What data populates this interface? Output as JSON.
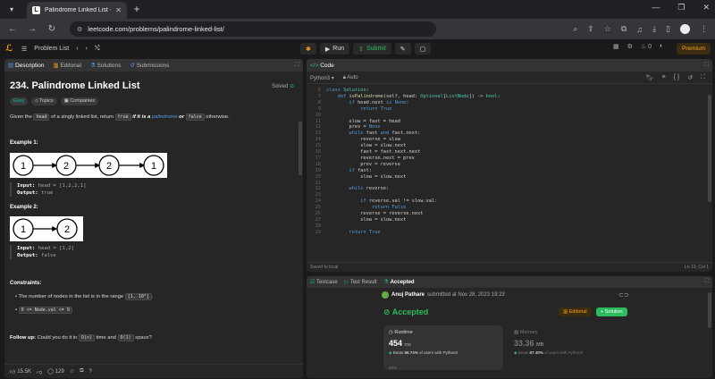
{
  "browser": {
    "tab_title": "Palindrome Linked List - LeetC",
    "url": "leetcode.com/problems/palindrome-linked-list/"
  },
  "nav": {
    "problem_list": "Problem List",
    "run": "Run",
    "submit": "Submit",
    "streak_count": "0",
    "premium": "Premium"
  },
  "left_tabs": [
    "Description",
    "Editorial",
    "Solutions",
    "Submissions"
  ],
  "problem": {
    "title": "234. Palindrome Linked List",
    "status": "Solved",
    "difficulty": "Easy",
    "topics": "Topics",
    "companies": "Companies",
    "desc_pre": "Given the ",
    "desc_code1": "head",
    "desc_mid1": " of a singly linked list, return ",
    "desc_code2": "true",
    "desc_em1": " if it is a ",
    "desc_link": "palindrome",
    "desc_em2": " or ",
    "desc_code3": "false",
    "desc_post": " otherwise.",
    "example1_title": "Example 1:",
    "example1_nodes": [
      "1",
      "2",
      "2",
      "1"
    ],
    "example1_input_label": "Input:",
    "example1_input": "head = [1,2,2,1]",
    "example1_output_label": "Output:",
    "example1_output": "true",
    "example2_title": "Example 2:",
    "example2_nodes": [
      "1",
      "2"
    ],
    "example2_input_label": "Input:",
    "example2_input": "head = [1,2]",
    "example2_output_label": "Output:",
    "example2_output": "false",
    "constraints_title": "Constraints:",
    "constraint1_pre": "The number of nodes in the list is in the range ",
    "constraint1_code": "[1, 10⁵]",
    "constraint1_post": ".",
    "constraint2_code": "0 <= Node.val <= 9",
    "followup_label": "Follow up:",
    "followup_pre": " Could you do it in ",
    "followup_code1": "O(n)",
    "followup_mid": " time and ",
    "followup_code2": "O(1)",
    "followup_post": " space?"
  },
  "left_bottom": {
    "likes": "15.5K",
    "comments": "129"
  },
  "code_panel": {
    "tab": "Code",
    "language": "Python3",
    "mode": "Auto",
    "saved": "Saved to local",
    "cursor": "Ln 10, Col 1",
    "line_numbers": [
      "6",
      "7",
      "8",
      "9",
      "10",
      "11",
      "12",
      "13",
      "14",
      "15",
      "16",
      "17",
      "18",
      "19",
      "20",
      "21",
      "22",
      "23",
      "24",
      "25",
      "26",
      "27",
      "28",
      "29"
    ],
    "lines": [
      "class Solution:",
      "    def isPalindrome(self, head: Optional[ListNode]) -> bool:",
      "        if head.next is None:",
      "            return True",
      "",
      "        slow = fast = head",
      "        prev = None",
      "        while fast and fast.next:",
      "            reverse = slow",
      "            slow = slow.next",
      "            fast = fast.next.next",
      "            reverse.next = prev",
      "            prev = reverse",
      "        if fast:",
      "            slow = slow.next",
      "",
      "        while reverse:",
      "",
      "            if reverse.val != slow.val:",
      "                return False",
      "            reverse = reverse.next",
      "            slow = slow.next",
      "",
      "        return True"
    ]
  },
  "result": {
    "tabs": [
      "Testcase",
      "Test Result",
      "Accepted"
    ],
    "user": "Anuj Pathare",
    "submitted": "submitted at Nov 28, 2023 19:23",
    "status": "Accepted",
    "editorial": "Editorial",
    "add_solution": "+ Solution",
    "runtime_label": "Runtime",
    "runtime_value": "454",
    "runtime_unit": "ms",
    "runtime_beats_pre": "Beats ",
    "runtime_beats_pct": "96.74%",
    "runtime_beats_post": " of users with Python3",
    "memory_label": "Memory",
    "memory_value": "33.36",
    "memory_unit": "MB",
    "memory_beats_pre": "Beats ",
    "memory_beats_pct": "87.48%",
    "memory_beats_post": " of users with Python3",
    "pct_label": "60%"
  },
  "colors": {
    "accent_green": "#2cbb5d",
    "accent_orange": "#ffa116",
    "easy_teal": "#00b8a3"
  }
}
